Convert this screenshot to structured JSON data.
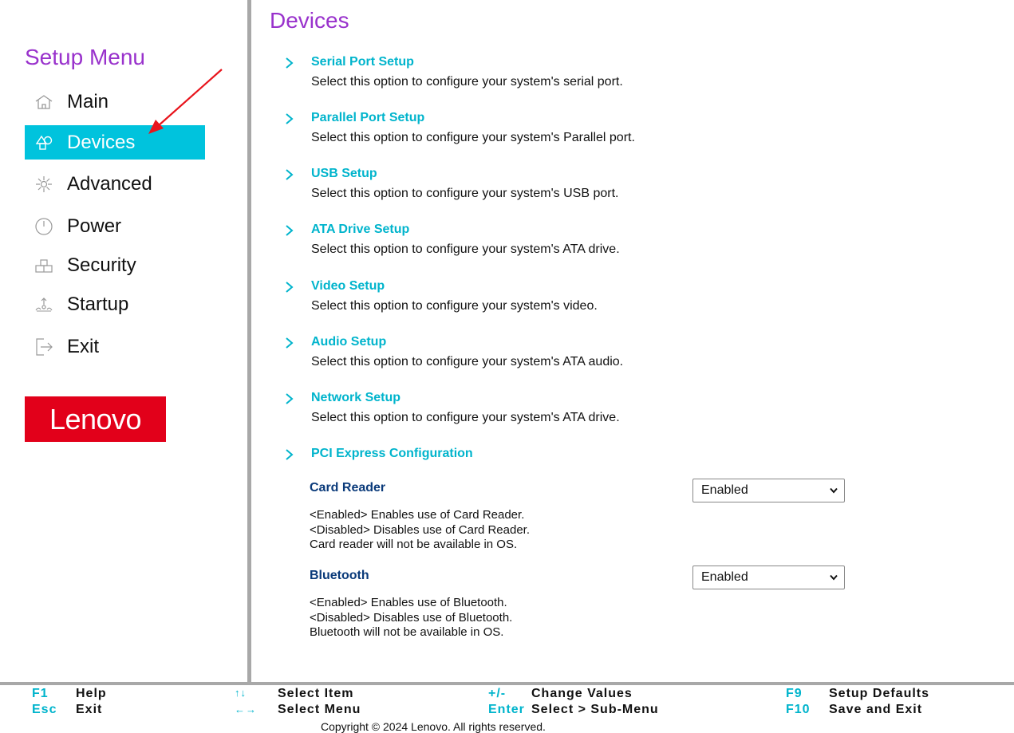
{
  "sidebar": {
    "title": "Setup Menu",
    "items": [
      {
        "label": "Main",
        "icon": "home-icon",
        "active": false
      },
      {
        "label": "Devices",
        "icon": "devices-icon",
        "active": true
      },
      {
        "label": "Advanced",
        "icon": "advanced-icon",
        "active": false
      },
      {
        "label": "Power",
        "icon": "power-icon",
        "active": false
      },
      {
        "label": "Security",
        "icon": "security-icon",
        "active": false
      },
      {
        "label": "Startup",
        "icon": "startup-icon",
        "active": false
      },
      {
        "label": "Exit",
        "icon": "exit-icon",
        "active": false
      }
    ],
    "logo_text": "Lenovo"
  },
  "main": {
    "title": "Devices",
    "menu_items": [
      {
        "title": "Serial Port Setup",
        "description": "Select this option to configure your system's serial port."
      },
      {
        "title": "Parallel Port Setup",
        "description": "Select this option to configure your system's Parallel port."
      },
      {
        "title": "USB Setup",
        "description": "Select this option to configure your system's USB port."
      },
      {
        "title": "ATA Drive Setup",
        "description": "Select this option to configure your system's ATA drive."
      },
      {
        "title": "Video Setup",
        "description": "Select this option to configure your system's video."
      },
      {
        "title": "Audio Setup",
        "description": "Select this option to configure your system's ATA audio."
      },
      {
        "title": "Network Setup",
        "description": "Select this option to configure your system's ATA drive."
      },
      {
        "title": "PCI Express Configuration",
        "description": ""
      }
    ],
    "settings": [
      {
        "name": "Card Reader",
        "value": "Enabled",
        "help": [
          "<Enabled> Enables use of Card Reader.",
          "<Disabled> Disables use of Card Reader.",
          "Card reader will not be available in OS."
        ]
      },
      {
        "name": "Bluetooth",
        "value": "Enabled",
        "help": [
          "<Enabled> Enables use of Bluetooth.",
          "<Disabled> Disables use of Bluetooth.",
          "Bluetooth will not be available in OS."
        ]
      }
    ]
  },
  "footer": {
    "keys": [
      {
        "key": "F1",
        "label": "Help"
      },
      {
        "key": "Esc",
        "label": "Exit"
      },
      {
        "key": "↑↓",
        "label": "Select Item"
      },
      {
        "key": "←→",
        "label": "Select Menu"
      },
      {
        "key": "+/-",
        "label": "Change Values"
      },
      {
        "key": "Enter",
        "label": "Select > Sub-Menu"
      },
      {
        "key": "F9",
        "label": "Setup Defaults"
      },
      {
        "key": "F10",
        "label": "Save and Exit"
      }
    ],
    "copyright": "Copyright © 2024 Lenovo. All rights reserved."
  },
  "colors": {
    "accent": "#00c3dd",
    "title_purple": "#9932cc",
    "link_cyan": "#00b4cc",
    "setting_navy": "#0a3a7a",
    "logo_red": "#e2001a",
    "annotation_red": "#e8141c"
  }
}
